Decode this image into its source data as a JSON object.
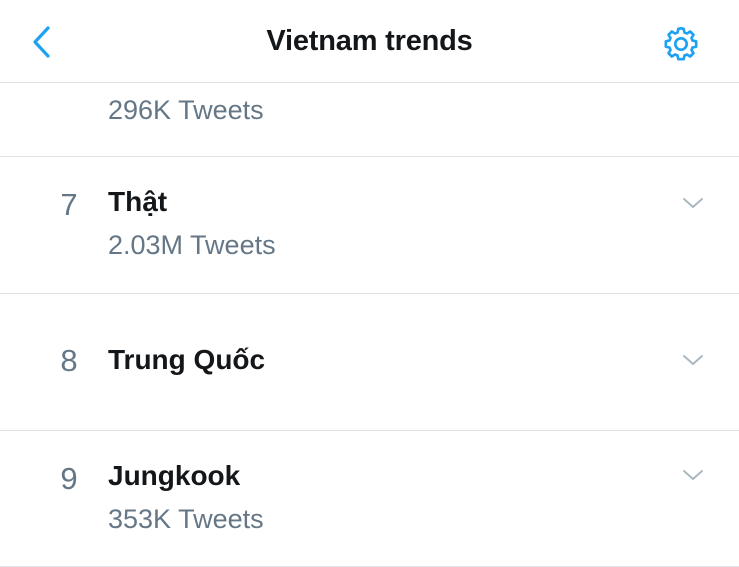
{
  "header": {
    "title": "Vietnam trends",
    "back_icon": "chevron-left-icon",
    "settings_icon": "gear-icon"
  },
  "colors": {
    "accent": "#1da1f2",
    "text_primary": "#14171a",
    "text_secondary": "#657786",
    "divider": "#dfe3e6",
    "chevron": "#aab8c2"
  },
  "trends": [
    {
      "rank": "",
      "name": "",
      "tweets": "296K Tweets"
    },
    {
      "rank": "7",
      "name": "Thật",
      "tweets": "2.03M Tweets"
    },
    {
      "rank": "8",
      "name": "Trung Quốc",
      "tweets": ""
    },
    {
      "rank": "9",
      "name": "Jungkook",
      "tweets": "353K Tweets"
    }
  ]
}
